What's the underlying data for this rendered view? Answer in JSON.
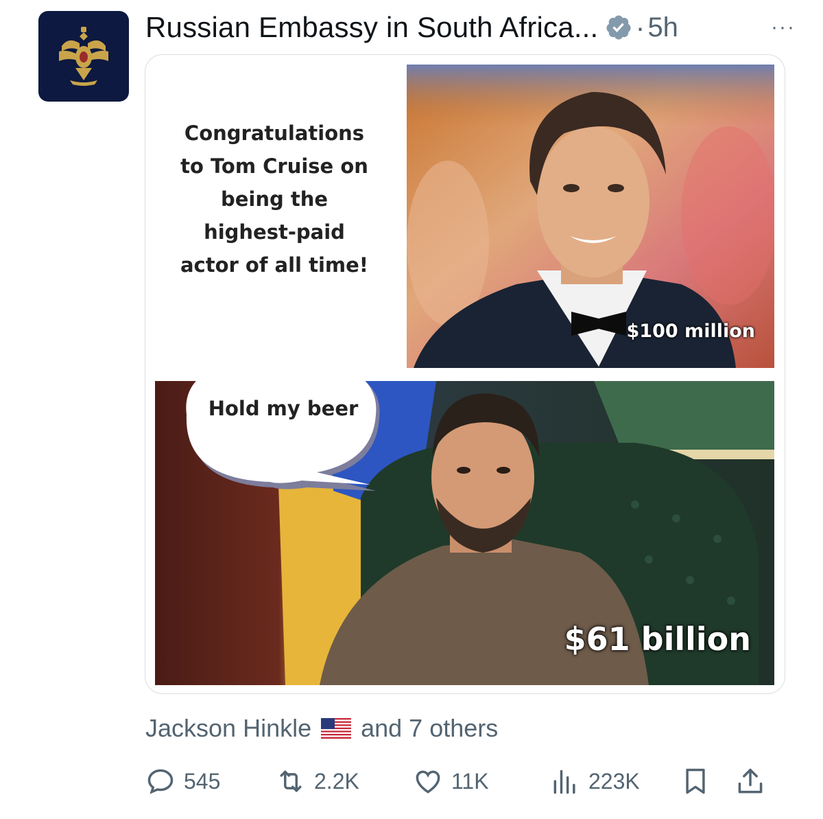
{
  "post": {
    "author": "Russian Embassy in South Africa...",
    "separator": "·",
    "time": "5h",
    "more": "···"
  },
  "image": {
    "caption_line1": "Congratulations",
    "caption_line2": "to Tom Cruise on",
    "caption_line3": "being the",
    "caption_line4": "highest-paid",
    "caption_line5": "actor of  all time!",
    "amount_top": "$100 million",
    "bubble_text": "Hold my beer",
    "amount_bottom": "$61 billion"
  },
  "social_context": {
    "name": "Jackson Hinkle",
    "suffix": "and 7 others"
  },
  "actions": {
    "replies": "545",
    "reposts": "2.2K",
    "likes": "11K",
    "views": "223K"
  },
  "colors": {
    "avatar_bg": "#0d1940",
    "verified": "#829aab",
    "secondary_text": "#536471"
  }
}
